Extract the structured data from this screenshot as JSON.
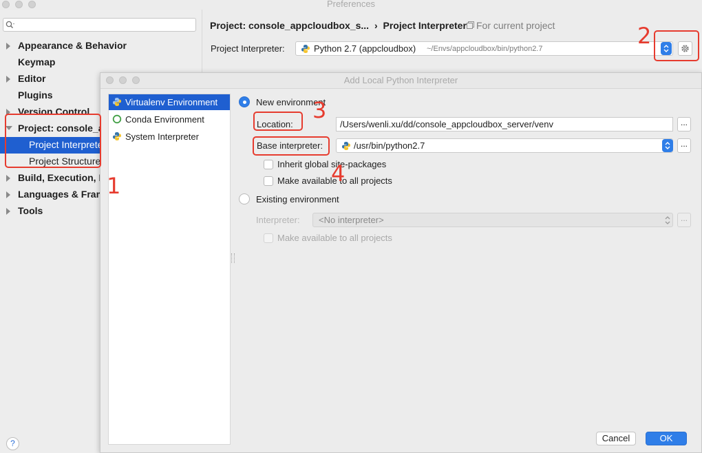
{
  "window": {
    "title": "Preferences"
  },
  "sidebar": {
    "search_placeholder": "",
    "items": [
      {
        "label": "Appearance & Behavior"
      },
      {
        "label": "Keymap"
      },
      {
        "label": "Editor"
      },
      {
        "label": "Plugins"
      },
      {
        "label": "Version Control"
      },
      {
        "label": "Project: console_a"
      },
      {
        "label": "Project Interprete"
      },
      {
        "label": "Project Structure"
      },
      {
        "label": "Build, Execution, D"
      },
      {
        "label": "Languages & Fram"
      },
      {
        "label": "Tools"
      }
    ],
    "help": "?"
  },
  "header": {
    "breadcrumb_project": "Project: console_appcloudbox_s...",
    "breadcrumb_sep": "›",
    "breadcrumb_page": "Project Interpreter",
    "scope": "For current project",
    "interpreter_label": "Project Interpreter:",
    "interpreter_value": "Python 2.7 (appcloudbox)",
    "interpreter_path": "~/Envs/appcloudbox/bin/python2.7"
  },
  "dialog": {
    "title": "Add Local Python Interpreter",
    "env_types": [
      {
        "label": "Virtualenv Environment",
        "selected": true
      },
      {
        "label": "Conda Environment",
        "selected": false
      },
      {
        "label": "System Interpreter",
        "selected": false
      }
    ],
    "new_env_label": "New environment",
    "location_label": "Location:",
    "location_value": "/Users/wenli.xu/dd/console_appcloudbox_server/venv",
    "base_label": "Base interpreter:",
    "base_value": "/usr/bin/python2.7",
    "inherit_label": "Inherit global site-packages",
    "make_available_label": "Make available to all projects",
    "existing_env_label": "Existing environment",
    "interpreter_label": "Interpreter:",
    "interpreter_value": "<No interpreter>",
    "make_available2_label": "Make available to all projects",
    "dots": "...",
    "cancel": "Cancel",
    "ok": "OK"
  },
  "annotations": [
    "1",
    "2",
    "3",
    "4"
  ],
  "colors": {
    "accent": "#2b6fd6",
    "selection": "#1f5fd0",
    "annotation": "#e63b2e"
  }
}
